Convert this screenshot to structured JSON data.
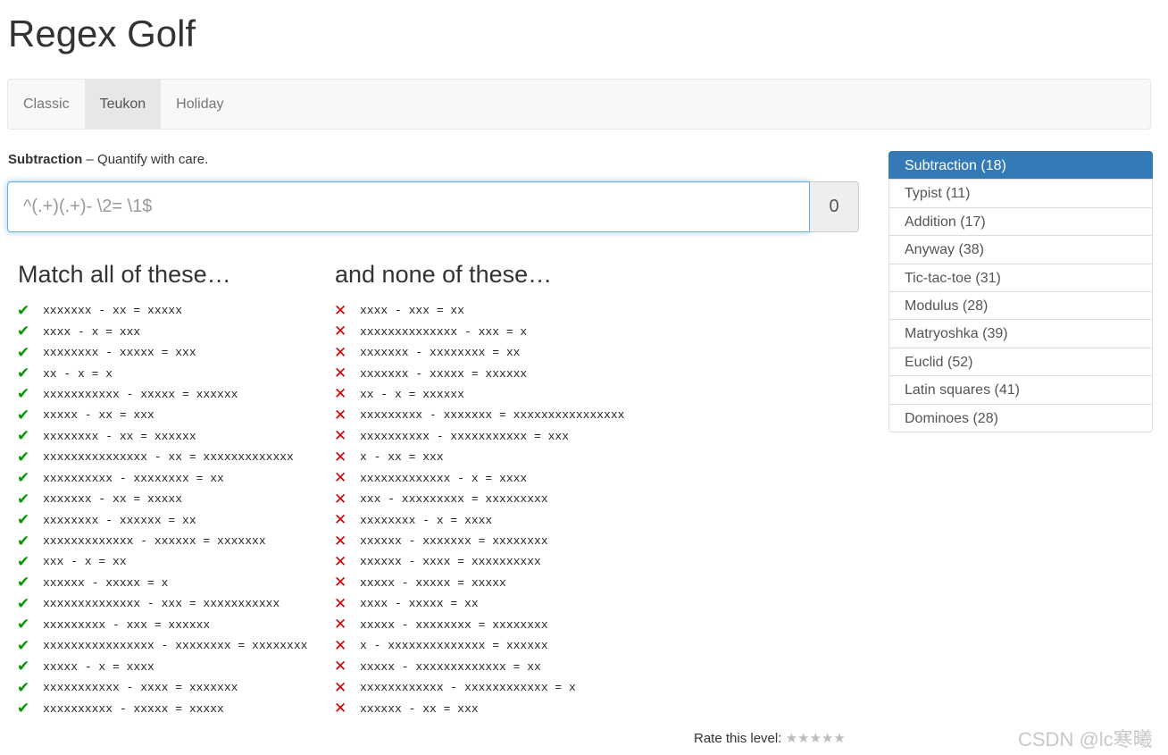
{
  "app": {
    "title": "Regex Golf"
  },
  "nav": {
    "tabs": [
      "Classic",
      "Teukon",
      "Holiday"
    ],
    "active": "Teukon"
  },
  "level": {
    "name": "Subtraction",
    "separator": " – ",
    "tagline": "Quantify with care."
  },
  "regex": {
    "value": "",
    "placeholder": "^(.+)(.+)- \\2= \\1$",
    "score": "0"
  },
  "match": {
    "heading": "Match all of these…",
    "items": [
      "xxxxxxx - xx = xxxxx",
      "xxxx - x = xxx",
      "xxxxxxxx - xxxxx = xxx",
      "xx - x = x",
      "xxxxxxxxxxx - xxxxx = xxxxxx",
      "xxxxx - xx = xxx",
      "xxxxxxxx - xx = xxxxxx",
      "xxxxxxxxxxxxxxx - xx = xxxxxxxxxxxxx",
      "xxxxxxxxxx - xxxxxxxx = xx",
      "xxxxxxx - xx = xxxxx",
      "xxxxxxxx - xxxxxx = xx",
      "xxxxxxxxxxxxx - xxxxxx = xxxxxxx",
      "xxx - x = xx",
      "xxxxxx - xxxxx = x",
      "xxxxxxxxxxxxxx - xxx = xxxxxxxxxxx",
      "xxxxxxxxx - xxx = xxxxxx",
      "xxxxxxxxxxxxxxxx - xxxxxxxx = xxxxxxxx",
      "xxxxx - x = xxxx",
      "xxxxxxxxxxx - xxxx = xxxxxxx",
      "xxxxxxxxxx - xxxxx = xxxxx"
    ]
  },
  "nomatch": {
    "heading": "and none of these…",
    "items": [
      "xxxx - xxx = xx",
      "xxxxxxxxxxxxxx - xxx = x",
      "xxxxxxx - xxxxxxxx = xx",
      "xxxxxxx - xxxxx = xxxxxx",
      "xx - x = xxxxxx",
      "xxxxxxxxx - xxxxxxx = xxxxxxxxxxxxxxxx",
      "xxxxxxxxxx - xxxxxxxxxxx = xxx",
      "x - xx = xxx",
      "xxxxxxxxxxxxx - x = xxxx",
      "xxx - xxxxxxxxx = xxxxxxxxx",
      "xxxxxxxx - x = xxxx",
      "xxxxxx - xxxxxxx = xxxxxxxx",
      "xxxxxx - xxxx = xxxxxxxxxx",
      "xxxxx - xxxxx = xxxxx",
      "xxxx - xxxxx = xx",
      "xxxxx - xxxxxxxx = xxxxxxxx",
      "x - xxxxxxxxxxxxxx = xxxxxx",
      "xxxxx - xxxxxxxxxxxxx = xx",
      "xxxxxxxxxxxx - xxxxxxxxxxxx = x",
      "xxxxxx - xx = xxx"
    ]
  },
  "levels": {
    "items": [
      "Subtraction (18)",
      "Typist (11)",
      "Addition (17)",
      "Anyway (38)",
      "Tic-tac-toe (31)",
      "Modulus (28)",
      "Matryoshka (39)",
      "Euclid (52)",
      "Latin squares (41)",
      "Dominoes (28)"
    ],
    "active_index": 0
  },
  "rating": {
    "label": "Rate this level:",
    "stars": "★★★★★"
  },
  "watermark": "CSDN @lc寒曦",
  "colors": {
    "accent": "#337ab7",
    "match_mark": "#009900",
    "nomatch_mark": "#cc0000",
    "focus": "#66afe9"
  },
  "icons": {
    "match": "check-icon",
    "nomatch": "cross-icon"
  }
}
